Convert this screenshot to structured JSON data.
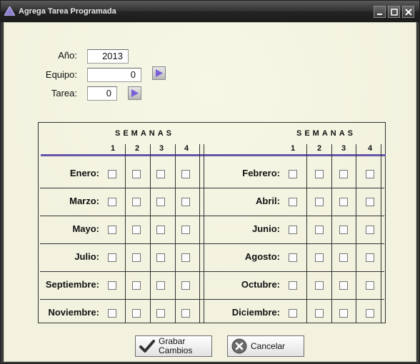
{
  "window": {
    "title": "Agrega Tarea Programada"
  },
  "form": {
    "anio_label": "Año:",
    "anio_value": "2013",
    "equipo_label": "Equipo:",
    "equipo_value": "0",
    "tarea_label": "Tarea:",
    "tarea_value": "0"
  },
  "grid": {
    "semanas_label": "SEMANAS",
    "weeks": [
      "1",
      "2",
      "3",
      "4"
    ],
    "left_months": [
      "Enero:",
      "Marzo:",
      "Mayo:",
      "Julio:",
      "Septiembre:",
      "Noviembre:"
    ],
    "right_months": [
      "Febrero:",
      "Abril:",
      "Junio:",
      "Agosto:",
      "Octubre:",
      "Diciembre:"
    ]
  },
  "buttons": {
    "grabar_line1": "Grabar",
    "grabar_line2": "Cambios",
    "cancelar": "Cancelar"
  },
  "colors": {
    "accent": "#6655a8",
    "background": "#f2f2df",
    "titlebar": "#232323"
  }
}
